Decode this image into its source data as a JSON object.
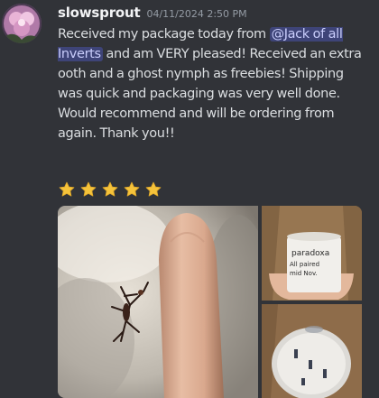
{
  "message": {
    "username": "slowsprout",
    "timestamp": "04/11/2024 2:50 PM",
    "text_before_mention": "Received my package today from ",
    "mention": "@Jack of all Inverts",
    "text_after_mention": " and am VERY pleased! Received an extra ooth and a ghost nymph as freebies! Shipping was quick and packaging was very well done. Would recommend and will be ordering from again. Thank you!!"
  },
  "reactions": {
    "count": 5,
    "icon": "star-icon",
    "color": "#f5c33b"
  },
  "attachments": {
    "label_line1": "paradoxa",
    "label_line2": "All paired",
    "label_line3": "mid Nov."
  },
  "colors": {
    "background": "#313338",
    "text": "#dbdee1",
    "username": "#f2f3f5",
    "timestamp": "#949ba4",
    "mention_bg": "#3c4270",
    "mention_text": "#c9cdfb"
  }
}
